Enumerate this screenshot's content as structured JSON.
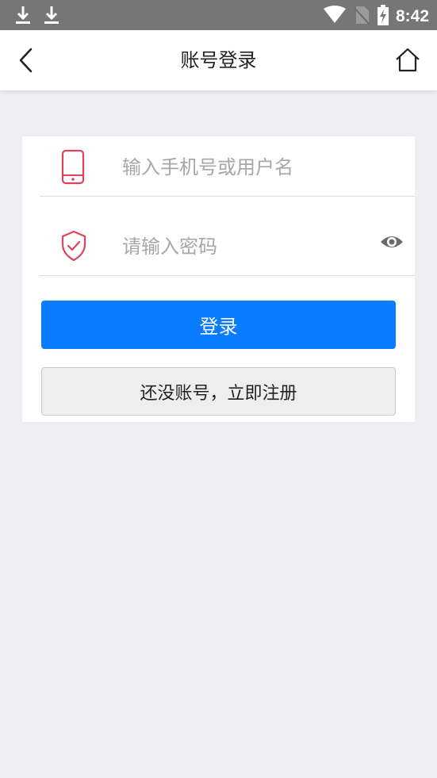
{
  "status_bar": {
    "time": "8:42",
    "left_icons": [
      "download-icon",
      "download-icon"
    ],
    "right_icons": [
      "wifi-icon",
      "no-sim-icon",
      "battery-charging-icon"
    ]
  },
  "header": {
    "title": "账号登录",
    "back_icon": "chevron-left-icon",
    "home_icon": "home-icon"
  },
  "form": {
    "phone_placeholder": "输入手机号或用户名",
    "phone_value": "",
    "password_placeholder": "请输入密码",
    "password_value": "",
    "phone_icon": "phone-icon",
    "password_icon": "shield-check-icon",
    "toggle_icon": "eye-icon",
    "login_label": "登录",
    "register_label": "还没账号，立即注册"
  },
  "colors": {
    "accent": "#0a7cff",
    "icon_red": "#e0435a",
    "background": "#eeeef3",
    "status_bar": "#767676"
  }
}
